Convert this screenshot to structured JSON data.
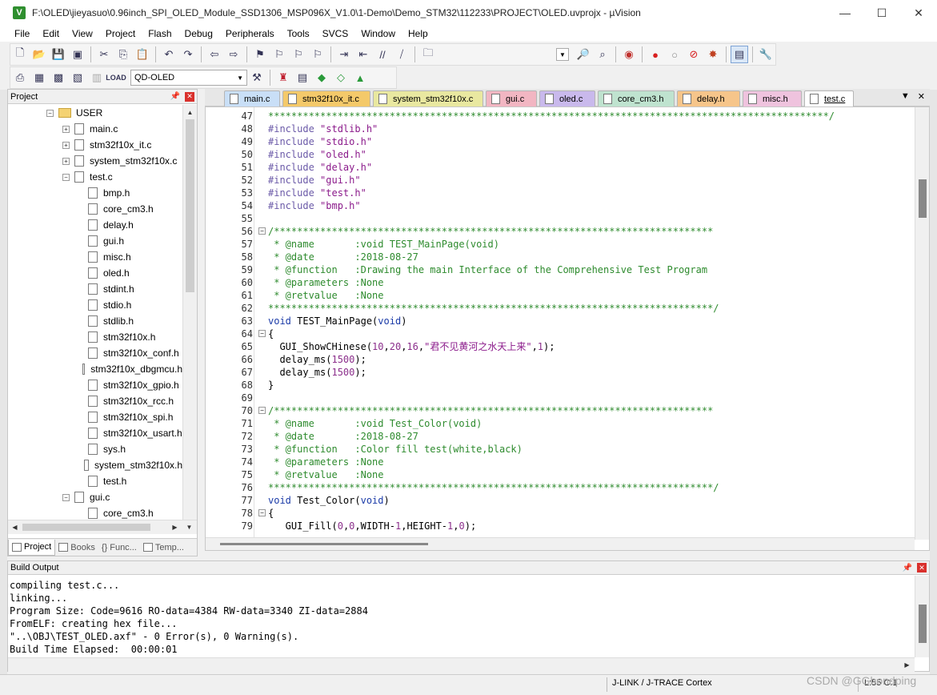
{
  "window": {
    "title": "F:\\OLED\\jieyasuo\\0.96inch_SPI_OLED_Module_SSD1306_MSP096X_V1.0\\1-Demo\\Demo_STM32\\112233\\PROJECT\\OLED.uvprojx - µVision",
    "app_icon": "V",
    "minimize": "—",
    "maximize": "☐",
    "close": "✕"
  },
  "menu": [
    "File",
    "Edit",
    "View",
    "Project",
    "Flash",
    "Debug",
    "Peripherals",
    "Tools",
    "SVCS",
    "Window",
    "Help"
  ],
  "toolbar2": {
    "target": "QD-OLED"
  },
  "project_panel": {
    "title": "Project",
    "tree": [
      {
        "label": "USER",
        "type": "folder",
        "depth": 0,
        "expander": "−"
      },
      {
        "label": "main.c",
        "type": "file",
        "depth": 1,
        "expander": "+"
      },
      {
        "label": "stm32f10x_it.c",
        "type": "file",
        "depth": 1,
        "expander": "+"
      },
      {
        "label": "system_stm32f10x.c",
        "type": "file",
        "depth": 1,
        "expander": "+"
      },
      {
        "label": "test.c",
        "type": "file",
        "depth": 1,
        "expander": "−"
      },
      {
        "label": "bmp.h",
        "type": "file",
        "depth": 2,
        "expander": ""
      },
      {
        "label": "core_cm3.h",
        "type": "file",
        "depth": 2,
        "expander": ""
      },
      {
        "label": "delay.h",
        "type": "file",
        "depth": 2,
        "expander": ""
      },
      {
        "label": "gui.h",
        "type": "file",
        "depth": 2,
        "expander": ""
      },
      {
        "label": "misc.h",
        "type": "file",
        "depth": 2,
        "expander": ""
      },
      {
        "label": "oled.h",
        "type": "file",
        "depth": 2,
        "expander": ""
      },
      {
        "label": "stdint.h",
        "type": "file",
        "depth": 2,
        "expander": ""
      },
      {
        "label": "stdio.h",
        "type": "file",
        "depth": 2,
        "expander": ""
      },
      {
        "label": "stdlib.h",
        "type": "file",
        "depth": 2,
        "expander": ""
      },
      {
        "label": "stm32f10x.h",
        "type": "file",
        "depth": 2,
        "expander": ""
      },
      {
        "label": "stm32f10x_conf.h",
        "type": "file",
        "depth": 2,
        "expander": ""
      },
      {
        "label": "stm32f10x_dbgmcu.h",
        "type": "file",
        "depth": 2,
        "expander": ""
      },
      {
        "label": "stm32f10x_gpio.h",
        "type": "file",
        "depth": 2,
        "expander": ""
      },
      {
        "label": "stm32f10x_rcc.h",
        "type": "file",
        "depth": 2,
        "expander": ""
      },
      {
        "label": "stm32f10x_spi.h",
        "type": "file",
        "depth": 2,
        "expander": ""
      },
      {
        "label": "stm32f10x_usart.h",
        "type": "file",
        "depth": 2,
        "expander": ""
      },
      {
        "label": "sys.h",
        "type": "file",
        "depth": 2,
        "expander": ""
      },
      {
        "label": "system_stm32f10x.h",
        "type": "file",
        "depth": 2,
        "expander": ""
      },
      {
        "label": "test.h",
        "type": "file",
        "depth": 2,
        "expander": ""
      },
      {
        "label": "gui.c",
        "type": "file",
        "depth": 1,
        "expander": "−"
      },
      {
        "label": "core_cm3.h",
        "type": "file",
        "depth": 2,
        "expander": ""
      }
    ],
    "tabs": [
      {
        "label": "Project",
        "active": true
      },
      {
        "label": "Books",
        "active": false
      },
      {
        "label": "{} Func...",
        "active": false
      },
      {
        "label": "Temp...",
        "active": false
      }
    ]
  },
  "editor_tabs": [
    {
      "label": "main.c",
      "color": "#c9dff7",
      "active": false
    },
    {
      "label": "stm32f10x_it.c",
      "color": "#f4c96a",
      "active": false
    },
    {
      "label": "system_stm32f10x.c",
      "color": "#e9e8a0",
      "active": false
    },
    {
      "label": "gui.c",
      "color": "#f2b6c2",
      "active": false
    },
    {
      "label": "oled.c",
      "color": "#c9b9ec",
      "active": false
    },
    {
      "label": "core_cm3.h",
      "color": "#bfe3cf",
      "active": false
    },
    {
      "label": "delay.h",
      "color": "#f6c58a",
      "active": false
    },
    {
      "label": "misc.h",
      "color": "#efc3de",
      "active": false
    },
    {
      "label": "test.c",
      "color": "#ffffff",
      "active": true
    }
  ],
  "code": [
    {
      "n": "47",
      "fold": "",
      "segs": [
        {
          "c": "cm",
          "t": "*************************************************************************************************/"
        }
      ]
    },
    {
      "n": "48",
      "fold": "",
      "segs": [
        {
          "c": "pp",
          "t": "#include "
        },
        {
          "c": "str",
          "t": "\"stdlib.h\""
        }
      ]
    },
    {
      "n": "49",
      "fold": "",
      "segs": [
        {
          "c": "pp",
          "t": "#include "
        },
        {
          "c": "str",
          "t": "\"stdio.h\""
        }
      ]
    },
    {
      "n": "50",
      "fold": "",
      "segs": [
        {
          "c": "pp",
          "t": "#include "
        },
        {
          "c": "str",
          "t": "\"oled.h\""
        }
      ]
    },
    {
      "n": "51",
      "fold": "",
      "segs": [
        {
          "c": "pp",
          "t": "#include "
        },
        {
          "c": "str",
          "t": "\"delay.h\""
        }
      ]
    },
    {
      "n": "52",
      "fold": "",
      "segs": [
        {
          "c": "pp",
          "t": "#include "
        },
        {
          "c": "str",
          "t": "\"gui.h\""
        }
      ]
    },
    {
      "n": "53",
      "fold": "",
      "segs": [
        {
          "c": "pp",
          "t": "#include "
        },
        {
          "c": "str",
          "t": "\"test.h\""
        }
      ]
    },
    {
      "n": "54",
      "fold": "",
      "segs": [
        {
          "c": "pp",
          "t": "#include "
        },
        {
          "c": "str",
          "t": "\"bmp.h\""
        }
      ]
    },
    {
      "n": "55",
      "fold": "",
      "segs": []
    },
    {
      "n": "56",
      "fold": "−",
      "segs": [
        {
          "c": "cm",
          "t": "/****************************************************************************"
        }
      ]
    },
    {
      "n": "57",
      "fold": "",
      "segs": [
        {
          "c": "cm",
          "t": " * @name       :void TEST_MainPage(void)"
        }
      ]
    },
    {
      "n": "58",
      "fold": "",
      "segs": [
        {
          "c": "cm",
          "t": " * @date       :2018-08-27"
        }
      ]
    },
    {
      "n": "59",
      "fold": "",
      "segs": [
        {
          "c": "cm",
          "t": " * @function   :Drawing the main Interface of the Comprehensive Test Program"
        }
      ]
    },
    {
      "n": "60",
      "fold": "",
      "segs": [
        {
          "c": "cm",
          "t": " * @parameters :None"
        }
      ]
    },
    {
      "n": "61",
      "fold": "",
      "segs": [
        {
          "c": "cm",
          "t": " * @retvalue   :None"
        }
      ]
    },
    {
      "n": "62",
      "fold": "",
      "segs": [
        {
          "c": "cm",
          "t": "*****************************************************************************/"
        }
      ]
    },
    {
      "n": "63",
      "fold": "",
      "segs": [
        {
          "c": "kw",
          "t": "void"
        },
        {
          "c": "plain",
          "t": " TEST_MainPage("
        },
        {
          "c": "kw",
          "t": "void"
        },
        {
          "c": "plain",
          "t": ")"
        }
      ]
    },
    {
      "n": "64",
      "fold": "−",
      "segs": [
        {
          "c": "plain",
          "t": "{"
        }
      ]
    },
    {
      "n": "65",
      "fold": "",
      "segs": [
        {
          "c": "plain",
          "t": "  GUI_ShowCHinese("
        },
        {
          "c": "num",
          "t": "10"
        },
        {
          "c": "plain",
          "t": ","
        },
        {
          "c": "num",
          "t": "20"
        },
        {
          "c": "plain",
          "t": ","
        },
        {
          "c": "num",
          "t": "16"
        },
        {
          "c": "plain",
          "t": ","
        },
        {
          "c": "str",
          "t": "\"君不见黄河之水天上来\""
        },
        {
          "c": "plain",
          "t": ","
        },
        {
          "c": "num",
          "t": "1"
        },
        {
          "c": "plain",
          "t": ");"
        }
      ]
    },
    {
      "n": "66",
      "fold": "",
      "segs": [
        {
          "c": "plain",
          "t": "  delay_ms("
        },
        {
          "c": "num",
          "t": "1500"
        },
        {
          "c": "plain",
          "t": ");"
        }
      ]
    },
    {
      "n": "67",
      "fold": "",
      "segs": [
        {
          "c": "plain",
          "t": "  delay_ms("
        },
        {
          "c": "num",
          "t": "1500"
        },
        {
          "c": "plain",
          "t": ");"
        }
      ]
    },
    {
      "n": "68",
      "fold": "",
      "segs": [
        {
          "c": "plain",
          "t": "}"
        }
      ]
    },
    {
      "n": "69",
      "fold": "",
      "segs": []
    },
    {
      "n": "70",
      "fold": "−",
      "segs": [
        {
          "c": "cm",
          "t": "/****************************************************************************"
        }
      ]
    },
    {
      "n": "71",
      "fold": "",
      "segs": [
        {
          "c": "cm",
          "t": " * @name       :void Test_Color(void)"
        }
      ]
    },
    {
      "n": "72",
      "fold": "",
      "segs": [
        {
          "c": "cm",
          "t": " * @date       :2018-08-27"
        }
      ]
    },
    {
      "n": "73",
      "fold": "",
      "segs": [
        {
          "c": "cm",
          "t": " * @function   :Color fill test(white,black)"
        }
      ]
    },
    {
      "n": "74",
      "fold": "",
      "segs": [
        {
          "c": "cm",
          "t": " * @parameters :None"
        }
      ]
    },
    {
      "n": "75",
      "fold": "",
      "segs": [
        {
          "c": "cm",
          "t": " * @retvalue   :None"
        }
      ]
    },
    {
      "n": "76",
      "fold": "",
      "segs": [
        {
          "c": "cm",
          "t": "*****************************************************************************/"
        }
      ]
    },
    {
      "n": "77",
      "fold": "",
      "segs": [
        {
          "c": "kw",
          "t": "void"
        },
        {
          "c": "plain",
          "t": " Test_Color("
        },
        {
          "c": "kw",
          "t": "void"
        },
        {
          "c": "plain",
          "t": ")"
        }
      ]
    },
    {
      "n": "78",
      "fold": "−",
      "segs": [
        {
          "c": "plain",
          "t": "{"
        }
      ]
    },
    {
      "n": "79",
      "fold": "",
      "segs": [
        {
          "c": "plain",
          "t": "   GUI_Fill("
        },
        {
          "c": "num",
          "t": "0"
        },
        {
          "c": "plain",
          "t": ","
        },
        {
          "c": "num",
          "t": "0"
        },
        {
          "c": "plain",
          "t": ",WIDTH-"
        },
        {
          "c": "num",
          "t": "1"
        },
        {
          "c": "plain",
          "t": ",HEIGHT-"
        },
        {
          "c": "num",
          "t": "1"
        },
        {
          "c": "plain",
          "t": ","
        },
        {
          "c": "num",
          "t": "0"
        },
        {
          "c": "plain",
          "t": ");"
        }
      ]
    }
  ],
  "build_output": {
    "title": "Build Output",
    "lines": [
      "compiling test.c...",
      "linking...",
      "Program Size: Code=9616 RO-data=4384 RW-data=3340 ZI-data=2884",
      "FromELF: creating hex file...",
      "\"..\\OBJ\\TEST_OLED.axf\" - 0 Error(s), 0 Warning(s).",
      "Build Time Elapsed:  00:00:01"
    ]
  },
  "status": {
    "debugger": "J-LINK / J-TRACE Cortex",
    "position": "L:55 C:1"
  },
  "watermark": "CSDN @GGbondping"
}
